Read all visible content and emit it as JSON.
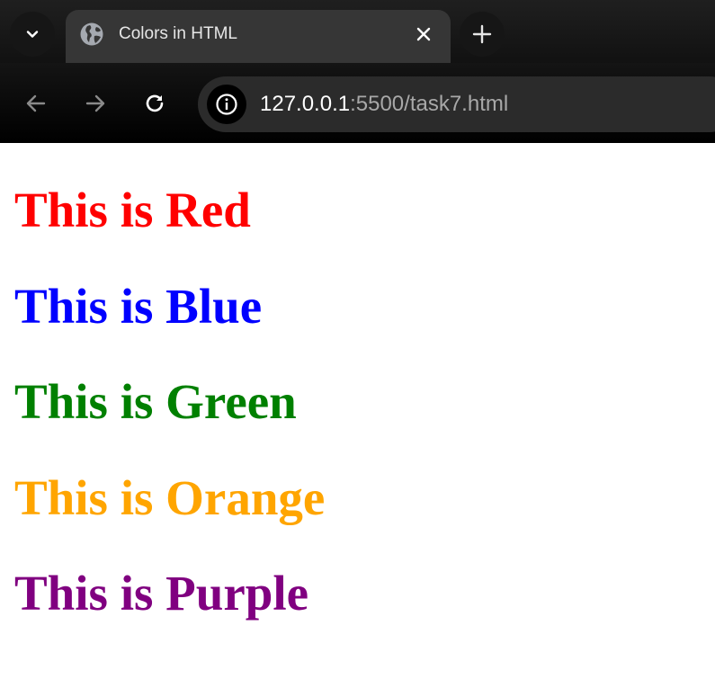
{
  "browser": {
    "tab": {
      "title": "Colors in HTML",
      "favicon": "globe-icon"
    },
    "tab_search_icon": "chevron-down-icon",
    "tab_close_icon": "close-icon",
    "new_tab_icon": "plus-icon",
    "nav": {
      "back_icon": "arrow-left-icon",
      "forward_icon": "arrow-right-icon",
      "reload_icon": "reload-icon"
    },
    "address_bar": {
      "site_info_icon": "info-icon",
      "url_host": "127.0.0.1",
      "url_rest": ":5500/task7.html"
    },
    "colors": {
      "chrome_bg": "#1f1f1f",
      "tab_bg": "#363636",
      "omnibox_bg": "#2b2b2b"
    }
  },
  "page": {
    "headings": [
      {
        "text": "This is Red",
        "color": "#ff0000"
      },
      {
        "text": "This is Blue",
        "color": "#0000ff"
      },
      {
        "text": "This is Green",
        "color": "#008000"
      },
      {
        "text": "This is Orange",
        "color": "#ffa500"
      },
      {
        "text": "This is Purple",
        "color": "#800080"
      }
    ]
  }
}
